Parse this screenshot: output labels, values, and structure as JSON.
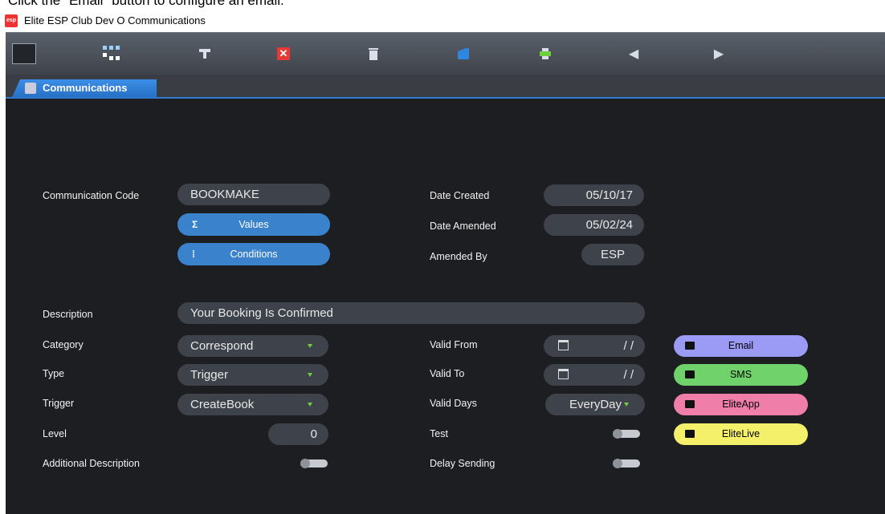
{
  "instruction": "Click the \"Email\" button to configure an email.",
  "window": {
    "title": "Elite ESP Club Dev O Communications",
    "icon_text": "esp"
  },
  "toolbar": {
    "icons": [
      "grid-view-icon",
      "tree-view-icon",
      "filter-icon",
      "close-icon",
      "delete-icon",
      "export-icon",
      "print-icon",
      "previous-icon",
      "next-icon"
    ]
  },
  "tab": {
    "label": "Communications"
  },
  "form": {
    "communication_code": {
      "label": "Communication Code",
      "value": "BOOKMAKE"
    },
    "values_button": {
      "icon": "Σ",
      "label": "Values"
    },
    "conditions_button": {
      "icon": "⁞",
      "label": "Conditions"
    },
    "date_created": {
      "label": "Date Created",
      "value": "05/10/17"
    },
    "date_amended": {
      "label": "Date Amended",
      "value": "05/02/24"
    },
    "amended_by": {
      "label": "Amended By",
      "value": "ESP"
    },
    "description": {
      "label": "Description",
      "value": "Your Booking Is Confirmed"
    },
    "category": {
      "label": "Category",
      "value": "Correspond"
    },
    "type": {
      "label": "Type",
      "value": "Trigger"
    },
    "trigger": {
      "label": "Trigger",
      "value": "CreateBook"
    },
    "level": {
      "label": "Level",
      "value": "0"
    },
    "additional_description": {
      "label": "Additional Description"
    },
    "valid_from": {
      "label": "Valid From",
      "value": "/ /"
    },
    "valid_to": {
      "label": "Valid To",
      "value": "/ /"
    },
    "valid_days": {
      "label": "Valid Days",
      "value": "EveryDay"
    },
    "test": {
      "label": "Test"
    },
    "delay_sending": {
      "label": "Delay Sending"
    }
  },
  "channels": [
    {
      "label": "Email",
      "color": "#9b9bf5",
      "icon": "email-icon"
    },
    {
      "label": "SMS",
      "color": "#6fd26a",
      "icon": "sms-icon"
    },
    {
      "label": "EliteApp",
      "color": "#ef7fa9",
      "icon": "people-icon"
    },
    {
      "label": "EliteLive",
      "color": "#f5f06a",
      "icon": "calendar-icon"
    }
  ]
}
